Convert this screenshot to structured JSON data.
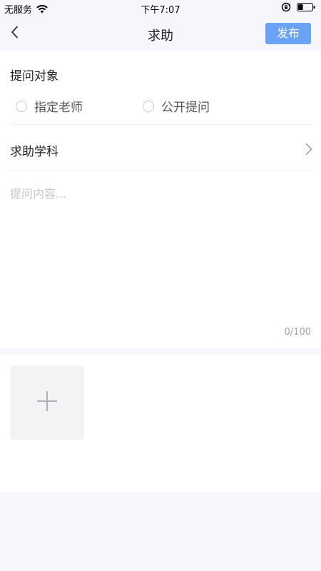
{
  "status_bar": {
    "carrier": "无服务",
    "time": "下午7:07",
    "battery_level": 0.35
  },
  "nav": {
    "title": "求助",
    "publish_label": "发布",
    "accent_color": "#6aa2f5"
  },
  "form": {
    "target_label": "提问对象",
    "options": [
      {
        "label": "指定老师",
        "selected": false
      },
      {
        "label": "公开提问",
        "selected": false
      }
    ],
    "subject_label": "求助学科",
    "content_placeholder": "提问内容...",
    "content_value": "",
    "char_count": "0/100"
  },
  "icons": {
    "back": "chevron-left-icon",
    "subject_arrow": "chevron-right-icon",
    "add_image": "plus-icon",
    "wifi": "wifi-icon",
    "rotation_lock": "rotation-lock-icon",
    "battery": "battery-icon"
  }
}
